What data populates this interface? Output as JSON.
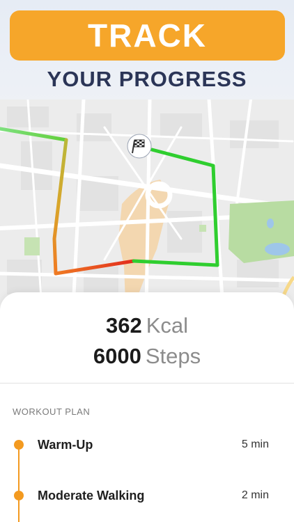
{
  "header": {
    "banner_text": "TRACK",
    "subtitle": "YOUR PROGRESS"
  },
  "map": {
    "finish_marker_icon": "checkered-flag-icon",
    "route_colors": {
      "good": "#2fce2f",
      "moderate": "#d9a52a",
      "intense": "#e8321e"
    },
    "park_color": "#b8dca2",
    "water_color": "#9ec6e9"
  },
  "stats": {
    "calories_value": "362",
    "calories_unit": "Kcal",
    "steps_value": "6000",
    "steps_unit": "Steps"
  },
  "workout_plan": {
    "label": "WORKOUT PLAN",
    "steps": [
      {
        "name": "Warm-Up",
        "duration": "5 min"
      },
      {
        "name": "Moderate Walking",
        "duration": "2 min"
      }
    ]
  },
  "colors": {
    "accent": "#f6a62a",
    "title": "#2b3557",
    "timeline": "#f39a20"
  }
}
